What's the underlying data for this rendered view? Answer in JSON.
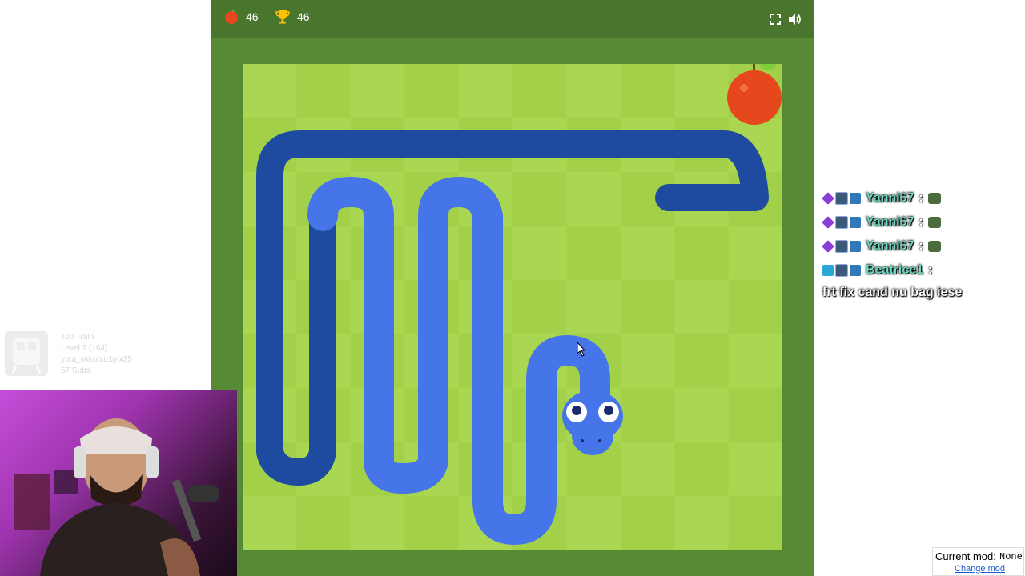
{
  "colors": {
    "game_bg": "#578a34",
    "topbar": "#4a752c",
    "grass_light": "#aad751",
    "grass_dark": "#a2d149",
    "snake_front": "#4674e9",
    "snake_back": "#1e4ba0",
    "apple": "#e7471d",
    "accent_name": "#6fd6c2"
  },
  "topbar": {
    "apple_icon": "apple-icon",
    "apple_count": "46",
    "trophy_icon": "trophy-icon",
    "best_score": "46",
    "fullscreen_icon": "fullscreen-icon",
    "sound_icon": "speaker-icon"
  },
  "board": {
    "cols": 10,
    "rows": 9,
    "apple_cell": [
      9,
      0
    ]
  },
  "chat": [
    {
      "badges": [
        "purple-gem",
        "bits",
        "vip"
      ],
      "user": "Yanni67",
      "separator": ":",
      "emote": "frog-emote"
    },
    {
      "badges": [
        "purple-gem",
        "bits",
        "vip"
      ],
      "user": "Yanni67",
      "separator": ":",
      "emote": "frog-emote"
    },
    {
      "badges": [
        "purple-gem",
        "bits",
        "vip"
      ],
      "user": "Yanni67",
      "separator": ":",
      "emote": "frog-emote"
    },
    {
      "badges": [
        "sword",
        "bits",
        "vip"
      ],
      "user": "Beatrice1",
      "separator": ":",
      "message": "frt fix cand nu bag iese"
    }
  ],
  "train": {
    "title": "Top Train",
    "level": "Level 7 (164)",
    "user": "yuta_okkotsu1p x35",
    "subs": "57 Subs"
  },
  "mod": {
    "label": "Current mod:",
    "value": "None",
    "link": "Change mod"
  }
}
